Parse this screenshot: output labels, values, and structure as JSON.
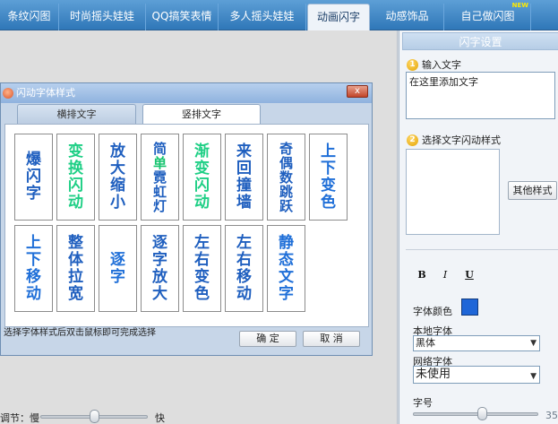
{
  "tabs": [
    {
      "label": "条纹闪图",
      "active": false
    },
    {
      "label": "时尚摇头娃娃",
      "active": false
    },
    {
      "label": "QQ搞笑表情",
      "active": false
    },
    {
      "label": "多人摇头娃娃",
      "active": false
    },
    {
      "label": "动画闪字",
      "active": true
    },
    {
      "label": "动感饰品",
      "active": false
    },
    {
      "label": "自己做闪图",
      "active": false,
      "badge": "NEW"
    }
  ],
  "right_panel": {
    "title": "闪字设置",
    "step1": {
      "num": "1",
      "label": "输入文字"
    },
    "text_input": {
      "value": "在这里添加文字"
    },
    "step2": {
      "num": "2",
      "label": "选择文字闪动样式"
    },
    "other_style_button": "其他样式",
    "format": {
      "bold": "B",
      "italic": "I",
      "underline": "U"
    },
    "font_color_label": "字体颜色",
    "font_color": "#1f66d8",
    "local_font_label": "本地字体",
    "local_font_value": "黑体",
    "web_font_label": "网络字体",
    "web_font_value": "未使用",
    "font_size_label": "字号",
    "font_size_value": "35",
    "font_size_fraction": 0.55
  },
  "dialog": {
    "title": "闪动字体样式",
    "close_glyph": "x",
    "tab_horizontal": "横排文字",
    "tab_vertical": "竖排文字",
    "hint": "选择字体样式后双击鼠标即可完成选择",
    "ok_label": "确  定",
    "cancel_label": "取 消",
    "cards": [
      {
        "chars": [
          "爆",
          "闪",
          "字"
        ],
        "color": "#1f5fbf"
      },
      {
        "chars": [
          "变",
          "换",
          "闪",
          "动"
        ],
        "color": "#1ecf85"
      },
      {
        "chars": [
          "放",
          "大",
          "缩",
          "小"
        ],
        "color": "#1f5fbf"
      },
      {
        "chars": [
          "简",
          "单",
          "霓",
          "虹",
          "灯"
        ],
        "color": "#1f5fbf",
        "highlight": "#16c46f"
      },
      {
        "chars": [
          "渐",
          "变",
          "闪",
          "动"
        ],
        "color": "#1ecf85"
      },
      {
        "chars": [
          "来",
          "回",
          "撞",
          "墙"
        ],
        "color": "#1f5fbf"
      },
      {
        "chars": [
          "奇",
          "偶",
          "数",
          "跳",
          "跃"
        ],
        "color": "#1f5fbf"
      },
      {
        "chars": [
          "上",
          "下",
          "变",
          "色"
        ],
        "color": "#1f6fd8"
      },
      {
        "chars": [
          "上",
          "下",
          "移",
          "动"
        ],
        "color": "#1f6fd8"
      },
      {
        "chars": [
          "整",
          "体",
          "拉",
          "宽"
        ],
        "color": "#1f5fbf"
      },
      {
        "chars": [
          "逐",
          "字"
        ],
        "color": "#1f6fd8"
      },
      {
        "chars": [
          "逐",
          "字",
          "放",
          "大"
        ],
        "color": "#1f5fbf"
      },
      {
        "chars": [
          "左",
          "右",
          "变",
          "色"
        ],
        "color": "#1f5fbf"
      },
      {
        "chars": [
          "左",
          "右",
          "移",
          "动"
        ],
        "color": "#1f5fbf"
      },
      {
        "chars": [
          "静",
          "态",
          "文",
          "字"
        ],
        "color": "#1f6fd8"
      }
    ]
  },
  "speed": {
    "label": "调节：慢",
    "fast_label": "快",
    "fraction": 0.5
  }
}
